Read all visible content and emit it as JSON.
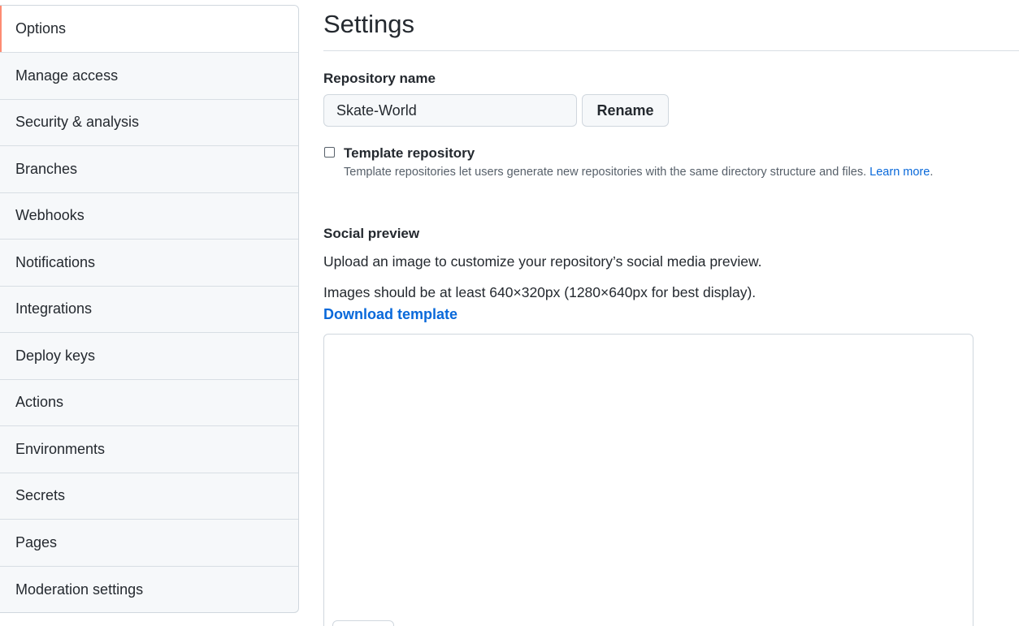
{
  "sidebar": {
    "items": [
      {
        "label": "Options",
        "selected": true
      },
      {
        "label": "Manage access"
      },
      {
        "label": "Security & analysis"
      },
      {
        "label": "Branches"
      },
      {
        "label": "Webhooks"
      },
      {
        "label": "Notifications"
      },
      {
        "label": "Integrations"
      },
      {
        "label": "Deploy keys"
      },
      {
        "label": "Actions"
      },
      {
        "label": "Environments"
      },
      {
        "label": "Secrets"
      },
      {
        "label": "Pages"
      },
      {
        "label": "Moderation settings"
      }
    ]
  },
  "main": {
    "title": "Settings",
    "repo_name": {
      "label": "Repository name",
      "value": "Skate-World",
      "rename_label": "Rename"
    },
    "template": {
      "label": "Template repository",
      "checked": false,
      "note": "Template repositories let users generate new repositories with the same directory structure and files.",
      "learn_more": "Learn more"
    },
    "social": {
      "label": "Social preview",
      "description": "Upload an image to customize your repository’s social media preview.",
      "size_note": "Images should be at least 640×320px (1280×640px for best display).",
      "download_label": "Download template"
    },
    "colors": {
      "accent": "#fd8c73",
      "link": "#0969da",
      "border": "#d0d7de",
      "sidebar_bg": "#f6f8fa"
    }
  }
}
